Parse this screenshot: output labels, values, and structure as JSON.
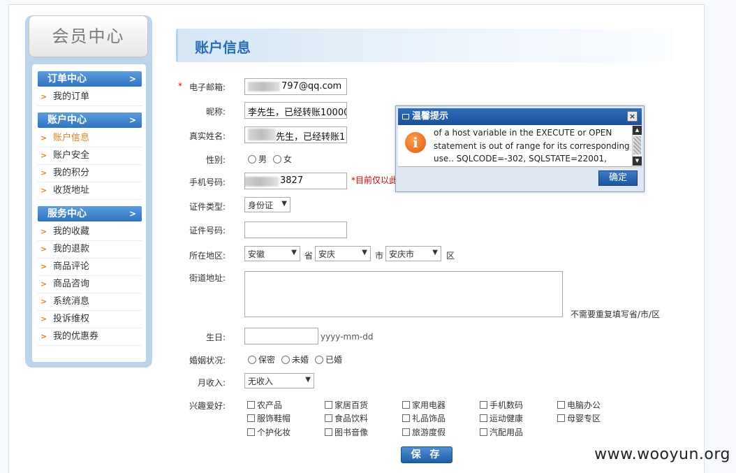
{
  "sidebar": {
    "title": "会员中心",
    "sections": [
      {
        "header": "订单中心",
        "items": [
          "我的订单"
        ]
      },
      {
        "header": "账户中心",
        "items": [
          "账户信息",
          "账户安全",
          "我的积分",
          "收货地址"
        ]
      },
      {
        "header": "服务中心",
        "items": [
          "我的收藏",
          "我的退款",
          "商品评论",
          "商品咨询",
          "系统消息",
          "投诉维权",
          "我的优惠券"
        ]
      }
    ],
    "active_item": "账户信息"
  },
  "page_title": "账户信息",
  "form": {
    "required_mark": "*",
    "email": {
      "label": "电子邮箱:",
      "value": "797@qq.com"
    },
    "nickname": {
      "label": "昵称:",
      "value": "李先生，已经转账10000"
    },
    "realname": {
      "label": "真实姓名:",
      "value": "先生，已经转账1"
    },
    "gender": {
      "label": "性别:",
      "options": [
        "男",
        "女"
      ]
    },
    "mobile": {
      "label": "手机号码:",
      "value": "3827",
      "hint": "*目前仅以此"
    },
    "id_type": {
      "label": "证件类型:",
      "value": "身份证"
    },
    "id_number": {
      "label": "证件号码:",
      "value": ""
    },
    "region": {
      "label": "所在地区:",
      "province": "安徽",
      "province_suffix": "省",
      "city": "安庆",
      "city_suffix": "市",
      "district": "安庆市",
      "district_suffix": "区"
    },
    "street": {
      "label": "街道地址:",
      "value": "",
      "hint": "不需要重复填写省/市/区"
    },
    "birthday": {
      "label": "生日:",
      "value": "",
      "hint": "yyyy-mm-dd"
    },
    "marital": {
      "label": "婚姻状况:",
      "options": [
        "保密",
        "未婚",
        "已婚"
      ]
    },
    "income": {
      "label": "月收入:",
      "value": "无收入"
    },
    "hobbies": {
      "label": "兴趣爱好:",
      "items": [
        "农产品",
        "家居百货",
        "家用电器",
        "手机数码",
        "电脑办公",
        "服饰鞋帽",
        "食品饮料",
        "礼品饰品",
        "运动健康",
        "母婴专区",
        "个护化妆",
        "图书音像",
        "旅游度假",
        "汽配用品"
      ]
    },
    "save_label": "保 存"
  },
  "dialog": {
    "title": "温馨提示",
    "close": "×",
    "message": "of a host variable in the EXECUTE or OPEN statement is out of range for its corresponding use.. SQLCODE=-302, SQLSTATE=22001,",
    "ok_label": "确定",
    "icon": "info-icon"
  },
  "watermark": "www.wooyun.org",
  "colors": {
    "accent": "#2b6db3",
    "active": "#e5801b",
    "dialog_title": "#1c4f99"
  }
}
